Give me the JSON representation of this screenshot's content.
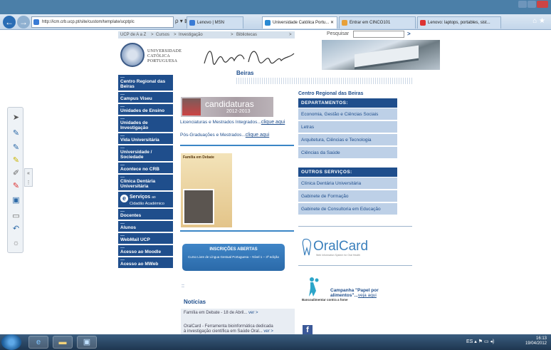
{
  "browser": {
    "address": "http://icm.crb.ucp.pt/site/custom/template/ucptplc",
    "address_controls": "ρ ▾ ⊠ C ✕",
    "tabs": [
      {
        "label": "Lenovo | MSN",
        "active": false,
        "color": "#3a7bd5"
      },
      {
        "label": "Universidade Católica Portu... ✕",
        "active": true,
        "color": "#2a8ad3"
      },
      {
        "label": "Entrar em CINCO101",
        "active": false,
        "color": "#e8a13a"
      },
      {
        "label": "Lenovo: laptops, portables, sist...",
        "active": false,
        "color": "#d33"
      }
    ],
    "toolbar_icons": "⌂ ★"
  },
  "site": {
    "topnav": [
      "UCP de A a Z",
      "Cursos",
      "Investigação",
      "Bibliotecas"
    ],
    "search_label": "Pesquisar",
    "search_go": ">",
    "logo_lines": [
      "UNIVERSIDADE",
      "CATÓLICA",
      "PORTUGUESA"
    ],
    "page_title": "Beiras",
    "left_menu": [
      "Centro Regional das Beiras",
      "Campus Viseu",
      "Unidades de Ensino",
      "Unidades de Investigação",
      "Vida Universitária",
      "Universidade / Sociedade",
      "Acontece no CRB",
      "Clínica Dentária Universitária"
    ],
    "services": {
      "title": "Serviços",
      "suffix": "ao",
      "subtitle": "Cidadão Académico"
    },
    "left_menu_bottom": [
      "Docentes",
      "Alunos",
      "WebMail UCP",
      "Acesso ao Moodle",
      "Acesso ao MWeb"
    ],
    "candidaturas": {
      "title": "candidaturas",
      "year": "2012-2013"
    },
    "links": [
      {
        "text": "Licenciaturas e Mestrados Integrados...",
        "cta": "clique aqui"
      },
      {
        "text": "Pós-Graduações e Mestrados...",
        "cta": "clique aqui"
      }
    ],
    "poster_title": "Família em Debate",
    "inscricoes": {
      "title": "INSCRIÇÕES ABERTAS",
      "text": "Curso Livre de Língua Gestual Portuguesa – Nível 1 – 3ª edição"
    },
    "small_marker": "::",
    "news_title": "Notícias",
    "news": [
      {
        "text": "Família em Debate - 18 de Abril...",
        "more": "ver >"
      },
      {
        "text": "OralCard - Ferramenta bioinformática dedicada",
        "more": ""
      },
      {
        "text": "à investigação científica em Saúde Oral...",
        "more": "ver >"
      }
    ],
    "right_title": "Centro Regional das Beiras",
    "departamentos_header": "DEPARTAMENTOS:",
    "departamentos": [
      "Economia, Gestão e Ciências Sociais",
      "Letras",
      "Arquitetura, Ciências e Tecnologia",
      "Ciências da Saúde"
    ],
    "servicos_header": "OUTROS SERVIÇOS:",
    "servicos": [
      "Clínica Dentária Universitária",
      "Gabinete de Formação",
      "Gabinete de Consultoria em Educação"
    ],
    "oralcard": "OralCard",
    "oralcard_sub": "Web Information System for Oral Health",
    "campanha": {
      "line1": "Campanha \"Papel por",
      "line2": "alimentos\"...",
      "cta": "veja aqui"
    },
    "bancoalimentar": "Bancoalimentar contra a fome",
    "facebook": "f"
  },
  "taskbar": {
    "lang": "ES",
    "time": "16:13",
    "date": "19/04/2012"
  }
}
